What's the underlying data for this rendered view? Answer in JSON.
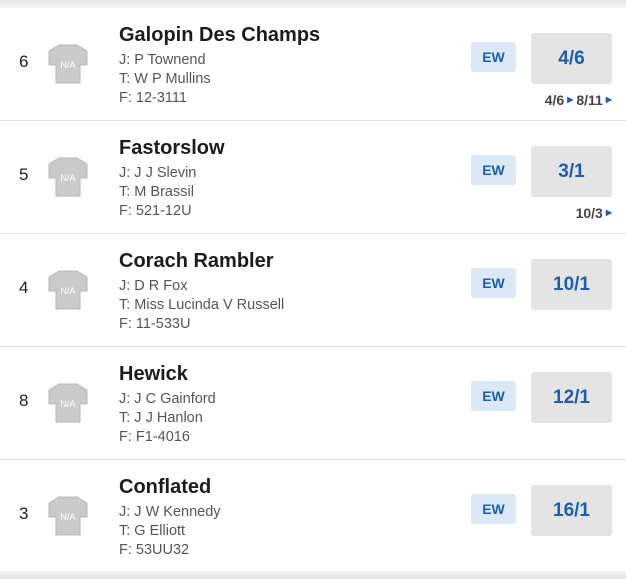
{
  "runners": [
    {
      "number": "6",
      "silk_text": "N/A",
      "name": "Galopin Des Champs",
      "jockey": "J: P Townend",
      "trainer": "T: W P Mullins",
      "form": "F: 12-3111",
      "ew_label": "EW",
      "odds": "4/6",
      "history": [
        "4/6",
        "8/11"
      ]
    },
    {
      "number": "5",
      "silk_text": "N/A",
      "name": "Fastorslow",
      "jockey": "J: J J Slevin",
      "trainer": "T: M Brassil",
      "form": "F: 521-12U",
      "ew_label": "EW",
      "odds": "3/1",
      "history": [
        "10/3"
      ]
    },
    {
      "number": "4",
      "silk_text": "N/A",
      "name": "Corach Rambler",
      "jockey": "J: D R Fox",
      "trainer": "T: Miss Lucinda V Russell",
      "form": "F: 11-533U",
      "ew_label": "EW",
      "odds": "10/1",
      "history": []
    },
    {
      "number": "8",
      "silk_text": "N/A",
      "name": "Hewick",
      "jockey": "J: J C Gainford",
      "trainer": "T: J J Hanlon",
      "form": "F: F1-4016",
      "ew_label": "EW",
      "odds": "12/1",
      "history": []
    },
    {
      "number": "3",
      "silk_text": "N/A",
      "name": "Conflated",
      "jockey": "J: J W Kennedy",
      "trainer": "T: G Elliott",
      "form": "F: 53UU32",
      "ew_label": "EW",
      "odds": "16/1",
      "history": []
    }
  ],
  "colors": {
    "accent": "#1f5ea8",
    "ew_bg": "#dbe9f7",
    "odds_bg": "#e4e4e4",
    "silk_gray": "#c9c9c9"
  },
  "icons": {
    "silk": "silk-placeholder-icon",
    "history_arrow": "triangle-right-icon"
  }
}
